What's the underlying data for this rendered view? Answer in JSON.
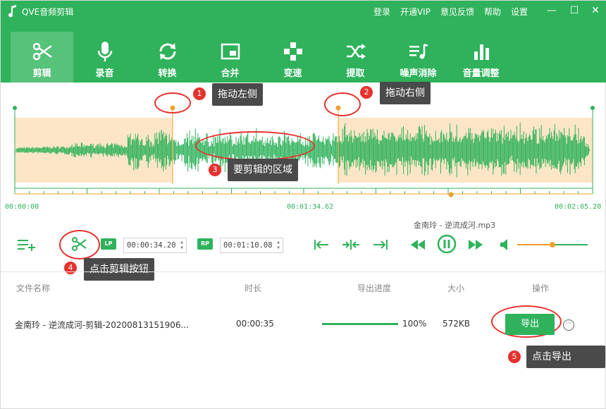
{
  "app": {
    "title": "QVE音频剪辑"
  },
  "topbar": {
    "links": [
      "登录",
      "开通VIP",
      "意见反馈",
      "帮助",
      "设置"
    ]
  },
  "window": {
    "minimize": "—",
    "maximize": "☐",
    "close": "✕"
  },
  "tools": [
    {
      "label": "剪辑",
      "icon": "scissors-icon",
      "active": true
    },
    {
      "label": "录音",
      "icon": "microphone-icon"
    },
    {
      "label": "转换",
      "icon": "convert-icon"
    },
    {
      "label": "合并",
      "icon": "merge-icon"
    },
    {
      "label": "变速",
      "icon": "speed-icon"
    },
    {
      "label": "提取",
      "icon": "extract-icon"
    },
    {
      "label": "噪声消除",
      "icon": "denoise-icon"
    },
    {
      "label": "音量调整",
      "icon": "volume-bars-icon"
    }
  ],
  "waveform": {
    "start_time": "00:00:00",
    "mid_time": "00:01:34.62",
    "end_time": "00:02:05.20",
    "callouts": [
      {
        "num": "1",
        "text": "拖动左侧"
      },
      {
        "num": "2",
        "text": "拖动右侧"
      },
      {
        "num": "3",
        "text": "要剪辑的区域"
      }
    ],
    "colors": {
      "wave": "#2fb25b",
      "selection_shade": "#fde6c7",
      "handle": "#f0a030",
      "annotation": "#e5322d"
    }
  },
  "controls": {
    "current_file": "金南玲 - 逆流成河.mp3",
    "lp_label": "LP",
    "rp_label": "RP",
    "lp_time": "00:00:34.20",
    "rp_time": "00:01:10.08",
    "callout_cut": {
      "num": "4",
      "text": "点击剪辑按钮"
    },
    "volume_level": 0.5
  },
  "table": {
    "headers": [
      "文件名称",
      "时长",
      "导出进度",
      "大小",
      "操作"
    ],
    "rows": [
      {
        "name": "金南玲 - 逆流成河-剪辑-20200813151906...",
        "duration": "00:00:35",
        "progress": 1.0,
        "progress_text": "100%",
        "size": "572KB",
        "action": "导出"
      }
    ],
    "callout_export": {
      "num": "5",
      "text": "点击导出"
    }
  }
}
